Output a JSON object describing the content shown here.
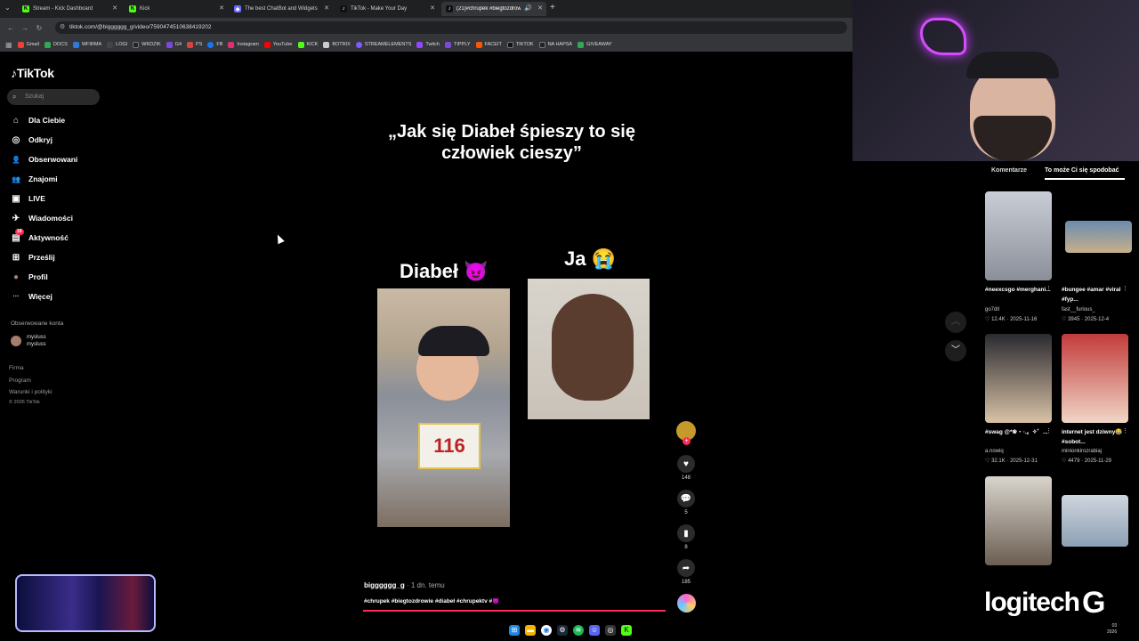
{
  "browser": {
    "tabs": [
      {
        "title": "Stream - Kick Dashboard",
        "favicon_color": "#53fc18",
        "favicon_glyph": "K"
      },
      {
        "title": "Kick",
        "favicon_color": "#53fc18",
        "favicon_glyph": "K"
      },
      {
        "title": "The best ChatBot and Widgets",
        "favicon_color": "#6a6aff",
        "favicon_glyph": "◆"
      },
      {
        "title": "TikTok - Make Your Day",
        "favicon_color": "#111111",
        "favicon_glyph": "♪"
      },
      {
        "title": "(21)#chrupek #biegtozdrowie",
        "favicon_color": "#111111",
        "favicon_glyph": "♪"
      }
    ],
    "new_tab_label": "+",
    "url": "tiktok.com/@bigggggg_g/video/7590474510638419202",
    "bookmarks": [
      {
        "label": "Gmail",
        "color": "#ea4335"
      },
      {
        "label": "DOCS",
        "color": "#34a853"
      },
      {
        "label": "WFIRMA",
        "color": "#2a7cd6"
      },
      {
        "label": "LOGI",
        "color": "#444444"
      },
      {
        "label": "WKDZIK",
        "color": "#222222"
      },
      {
        "label": "G4",
        "color": "#7a4ad6"
      },
      {
        "label": "PS",
        "color": "#d6453a"
      },
      {
        "label": "FB",
        "color": "#1877f2"
      },
      {
        "label": "Instagram",
        "color": "#e1306c"
      },
      {
        "label": "YouTube",
        "color": "#ff0000"
      },
      {
        "label": "KICK",
        "color": "#53fc18"
      },
      {
        "label": "BOTRIX",
        "color": "#cccccc"
      },
      {
        "label": "STREAMELEMENTS",
        "color": "#7d5cff"
      },
      {
        "label": "Twitch",
        "color": "#9146ff"
      },
      {
        "label": "TIPPLY",
        "color": "#7a4ad6"
      },
      {
        "label": "FACEIT",
        "color": "#ff5500"
      },
      {
        "label": "TIKTOK",
        "color": "#111111"
      },
      {
        "label": "NA HAPSA",
        "color": "#222222"
      },
      {
        "label": "GIVEAWAY",
        "color": "#34a853"
      }
    ]
  },
  "tiktok": {
    "logo": "TikTok",
    "search_placeholder": "Szukaj",
    "nav": [
      {
        "label": "Dla Ciebie",
        "icon": "home-icon",
        "glyph": "⌂"
      },
      {
        "label": "Odkryj",
        "icon": "compass-icon",
        "glyph": "◎"
      },
      {
        "label": "Obserwowani",
        "icon": "following-icon",
        "glyph": "👤"
      },
      {
        "label": "Znajomi",
        "icon": "friends-icon",
        "glyph": "👥"
      },
      {
        "label": "LIVE",
        "icon": "live-icon",
        "glyph": "▣"
      },
      {
        "label": "Wiadomości",
        "icon": "messages-icon",
        "glyph": "✈"
      },
      {
        "label": "Aktywność",
        "icon": "activity-icon",
        "glyph": "▤",
        "badge": "19"
      },
      {
        "label": "Prześlij",
        "icon": "upload-icon",
        "glyph": "⊞"
      },
      {
        "label": "Profil",
        "icon": "profile-avatar-icon",
        "glyph": "●"
      },
      {
        "label": "Więcej",
        "icon": "more-icon",
        "glyph": "···"
      }
    ],
    "followed_title": "Obserwowane konta",
    "followed_account": {
      "name": "mysluss",
      "handle": "mysluss"
    },
    "footer": [
      "Firma",
      "Program",
      "Warunki i polityki",
      "© 2026 TikTok"
    ]
  },
  "video": {
    "overlay_text": "„Jak się Diabeł śpieszy to się człowiek cieszy”",
    "label_left": "Diabeł 😈",
    "label_right": "Ja 😭",
    "bib_number": "116",
    "author": "bigggggg_g",
    "posted": "· 1 dn. temu",
    "hashtags": "#chrupek #biegtozdrowie #diabeł #chrupektv #😈",
    "progress": 1.0,
    "actions": {
      "likes": "148",
      "comments": "5",
      "saves": "8",
      "shares": "185"
    },
    "follow_plus": "+"
  },
  "panel": {
    "tab_comments": "Komentarze",
    "tab_suggested": "To może Ci się spodobać",
    "items": [
      {
        "caption": "#neexcsgo #merghani...",
        "user": "go7dll",
        "likes": "12.4K",
        "date": "2025-11-16",
        "color_a": "#c9ced6",
        "color_b": "#8a8f99"
      },
      {
        "caption": "#bungee #amar #viral #fyp...",
        "user": "fast__furious_",
        "likes": "3945",
        "date": "2025-12-4",
        "color_a": "#6c8bb0",
        "color_b": "#c7b08a"
      },
      {
        "caption": "#swag @*❀・◦.。✧゜...",
        "user": "a.nowiq",
        "likes": "32.1K",
        "date": "2025-12-31",
        "color_a": "#2a2a30",
        "color_b": "#d9c2a6"
      },
      {
        "caption": "internet jest dziwny😂 #sobot...",
        "user": "minionkirozrabiaj",
        "likes": "4479",
        "date": "2025-11-29",
        "color_a": "#c23b3b",
        "color_b": "#f0d6c6"
      },
      {
        "caption": "",
        "user": "",
        "likes": "",
        "date": "",
        "color_a": "#d8d4cc",
        "color_b": "#6b5e52"
      },
      {
        "caption": "",
        "user": "",
        "likes": "",
        "date": "",
        "color_a": "#cfd6de",
        "color_b": "#8da0b4"
      }
    ]
  },
  "overlay": {
    "sponsor": "logitech",
    "sponsor_mark": "G"
  },
  "taskbar": {
    "clock_time": "03",
    "clock_date": "2026"
  }
}
